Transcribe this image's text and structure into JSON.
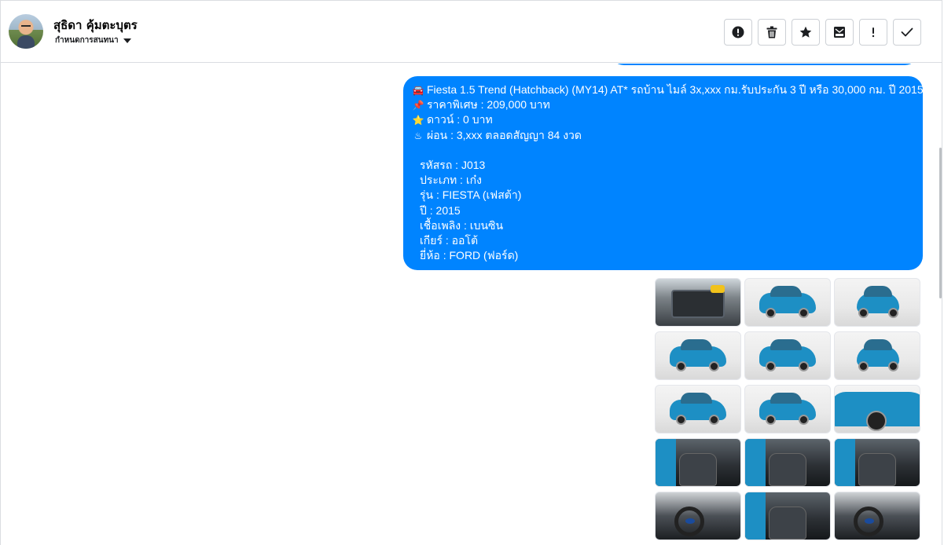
{
  "header": {
    "contact_name": "สุธิดา คุ้มตะบุตร",
    "assign_label": "กำหนดการสนทนา",
    "actions": [
      {
        "name": "report-button",
        "icon": "alert-circle-icon"
      },
      {
        "name": "delete-button",
        "icon": "trash-icon"
      },
      {
        "name": "star-button",
        "icon": "star-icon"
      },
      {
        "name": "archive-button",
        "icon": "envelope-archive-icon"
      },
      {
        "name": "mark-important-button",
        "icon": "exclamation-icon"
      },
      {
        "name": "mark-done-button",
        "icon": "check-icon"
      }
    ]
  },
  "message": {
    "bubble_color": "#0084ff",
    "lines": [
      {
        "emoji": "🚘",
        "text": "Fiesta 1.5 Trend (Hatchback) (MY14) AT* รถบ้าน ไมล์ 3x,xxx กม.รับประกัน 3 ปี หรือ 30,000 กม. ปี 2015"
      },
      {
        "emoji": "📌",
        "text": "ราคาพิเศษ : 209,000 บาท"
      },
      {
        "emoji": "⭐",
        "text": "ดาวน์ : 0 บาท"
      },
      {
        "emoji": "♨",
        "text": "ผ่อน : 3,xxx ตลอดสัญญา 84 งวด"
      }
    ],
    "specs": [
      "รหัสรถ : J013",
      "ประเภท : เก๋ง",
      "รุ่น : FIESTA (เฟสต้า)",
      "ปี : 2015",
      "เชื้อเพลิง : เบนซิน",
      "เกียร์ : ออโต้",
      "ยี่ห้อ : FORD (ฟอร์ด)"
    ]
  },
  "gallery": {
    "images": [
      {
        "kind": "engine"
      },
      {
        "kind": "side"
      },
      {
        "kind": "front"
      },
      {
        "kind": "side"
      },
      {
        "kind": "side"
      },
      {
        "kind": "front"
      },
      {
        "kind": "side"
      },
      {
        "kind": "side"
      },
      {
        "kind": "zoom"
      },
      {
        "kind": "interior"
      },
      {
        "kind": "interior"
      },
      {
        "kind": "interior"
      },
      {
        "kind": "dash"
      },
      {
        "kind": "interior"
      },
      {
        "kind": "dash"
      }
    ]
  }
}
